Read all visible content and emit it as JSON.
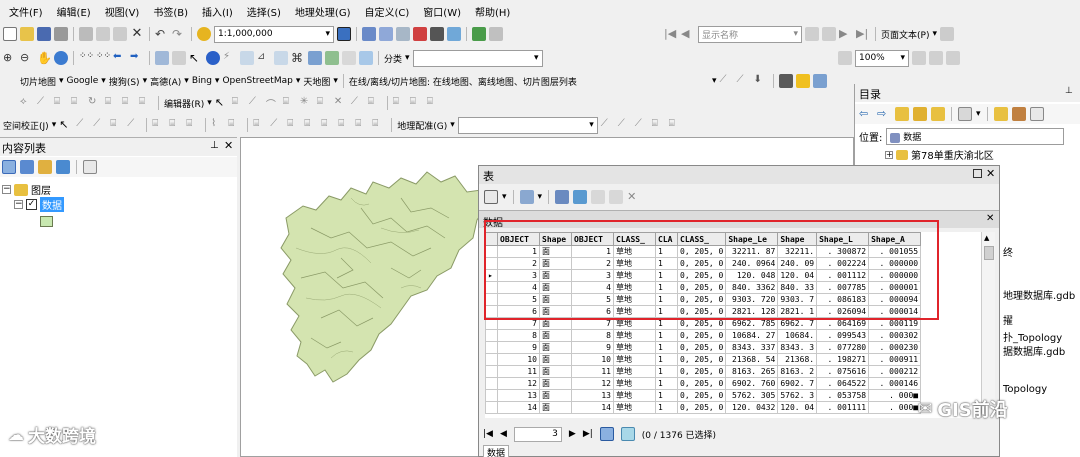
{
  "menu": [
    "文件(F)",
    "编辑(E)",
    "视图(V)",
    "书签(B)",
    "插入(I)",
    "选择(S)",
    "地理处理(G)",
    "自定义(C)",
    "窗口(W)",
    "帮助(H)"
  ],
  "toolbar": {
    "scale": "1:1,000,000",
    "display_name": "显示名称",
    "page_text": "页面文本(P)",
    "classify": "分类",
    "zoom": "100%"
  },
  "tiles": {
    "label": "切片地图",
    "items": [
      "Google",
      "搜狗(S)",
      "高德(A)",
      "Bing",
      "OpenStreetMap",
      "天地图"
    ],
    "online": "在线/离线/切片地图: 在线地图、离线地图、切片图层列表"
  },
  "editor": {
    "label": "编辑器(R)"
  },
  "spatial": {
    "label": "空间校正(J)",
    "georef": "地理配准(G)"
  },
  "toc": {
    "title": "内容列表",
    "root": "图层",
    "layer": "数据"
  },
  "catalog": {
    "title": "目录",
    "location_label": "位置:",
    "location_value": "数据",
    "tree_item": "第78单重庆渝北区",
    "partial_items": [
      "终",
      "地理数据库.gdb",
      "擢",
      "扑_Topology",
      "据数据库.gdb",
      "Topology"
    ]
  },
  "table_window": {
    "title": "表",
    "tab": "数据",
    "bottom_tab": "数据",
    "page": "3",
    "selection": "(0 / 1376 已选择)"
  },
  "attr_table": {
    "columns": [
      "OBJECT",
      "Shape",
      "OBJECT",
      "CLASS_",
      "CLA",
      "CLASS_",
      "Shape_Le",
      "Shape",
      "Shape_L",
      "Shape_A"
    ],
    "rows": [
      [
        "1",
        "面",
        "1",
        "草地",
        "1",
        "0, 205, 0",
        "32211. 87",
        "32211.",
        ". 300872",
        ". 001055"
      ],
      [
        "2",
        "面",
        "2",
        "草地",
        "1",
        "0, 205, 0",
        "240. 0964",
        "240. 09",
        ". 002224",
        ". 000000"
      ],
      [
        "3",
        "面",
        "3",
        "草地",
        "1",
        "0, 205, 0",
        "120. 048",
        "120. 04",
        ". 001112",
        ". 000000"
      ],
      [
        "4",
        "面",
        "4",
        "草地",
        "1",
        "0, 205, 0",
        "840. 3362",
        "840. 33",
        ". 007785",
        ". 000001"
      ],
      [
        "5",
        "面",
        "5",
        "草地",
        "1",
        "0, 205, 0",
        "9303. 720",
        "9303. 7",
        ". 086183",
        ". 000094"
      ],
      [
        "6",
        "面",
        "6",
        "草地",
        "1",
        "0, 205, 0",
        "2821. 128",
        "2821. 1",
        ". 026094",
        ". 000014"
      ],
      [
        "7",
        "面",
        "7",
        "草地",
        "1",
        "0, 205, 0",
        "6962. 785",
        "6962. 7",
        ". 064169",
        ". 000119"
      ],
      [
        "8",
        "面",
        "8",
        "草地",
        "1",
        "0, 205, 0",
        "10684. 27",
        "10684.",
        ". 099543",
        ". 000302"
      ],
      [
        "9",
        "面",
        "9",
        "草地",
        "1",
        "0, 205, 0",
        "8343. 337",
        "8343. 3",
        ". 077280",
        ". 000230"
      ],
      [
        "10",
        "面",
        "10",
        "草地",
        "1",
        "0, 205, 0",
        "21368. 54",
        "21368.",
        ". 198271",
        ". 000911"
      ],
      [
        "11",
        "面",
        "11",
        "草地",
        "1",
        "0, 205, 0",
        "8163. 265",
        "8163. 2",
        ". 075616",
        ". 000212"
      ],
      [
        "12",
        "面",
        "12",
        "草地",
        "1",
        "0, 205, 0",
        "6902. 760",
        "6902. 7",
        ". 064522",
        ". 000146"
      ],
      [
        "13",
        "面",
        "13",
        "草地",
        "1",
        "0, 205, 0",
        "5762. 305",
        "5762. 3",
        ". 053758",
        ". 000■"
      ],
      [
        "14",
        "面",
        "14",
        "草地",
        "1",
        "0, 205, 0",
        "120. 0432",
        "120. 04",
        ". 001111",
        ". 000■"
      ]
    ]
  },
  "watermarks": {
    "left": "大数跨境",
    "right": "GIS前沿"
  },
  "colors": {
    "highlight": "#e0242b",
    "polygon_fill": "#d4e4b0",
    "polygon_stroke": "#8a9a66",
    "layer_swatch": "#c8e8b0",
    "selection_bg": "#3399ff"
  }
}
